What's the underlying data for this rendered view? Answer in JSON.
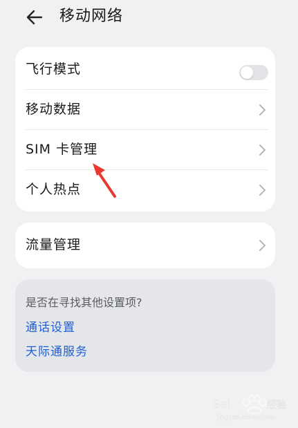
{
  "header": {
    "title": "移动网络",
    "back_icon": "arrow-left-icon"
  },
  "main_settings": {
    "items": [
      {
        "label": "飞行模式",
        "control": "toggle",
        "toggle_on": false
      },
      {
        "label": "移动数据",
        "control": "chevron"
      },
      {
        "label": "SIM 卡管理",
        "control": "chevron"
      },
      {
        "label": "个人热点",
        "control": "chevron"
      }
    ]
  },
  "data_settings": {
    "items": [
      {
        "label": "流量管理",
        "control": "chevron"
      }
    ]
  },
  "suggestions": {
    "title": "是否在寻找其他设置项?",
    "links": [
      "通话设置",
      "天际通服务"
    ]
  },
  "annotation": {
    "type": "red-arrow",
    "color": "#e8382f",
    "target": "SIM 卡管理"
  },
  "colors": {
    "background": "#f0f1f3",
    "card": "#ffffff",
    "suggestion_card": "#e4e6e9",
    "link": "#1f5fd6",
    "toggle_off": "#e2e3e6"
  }
}
